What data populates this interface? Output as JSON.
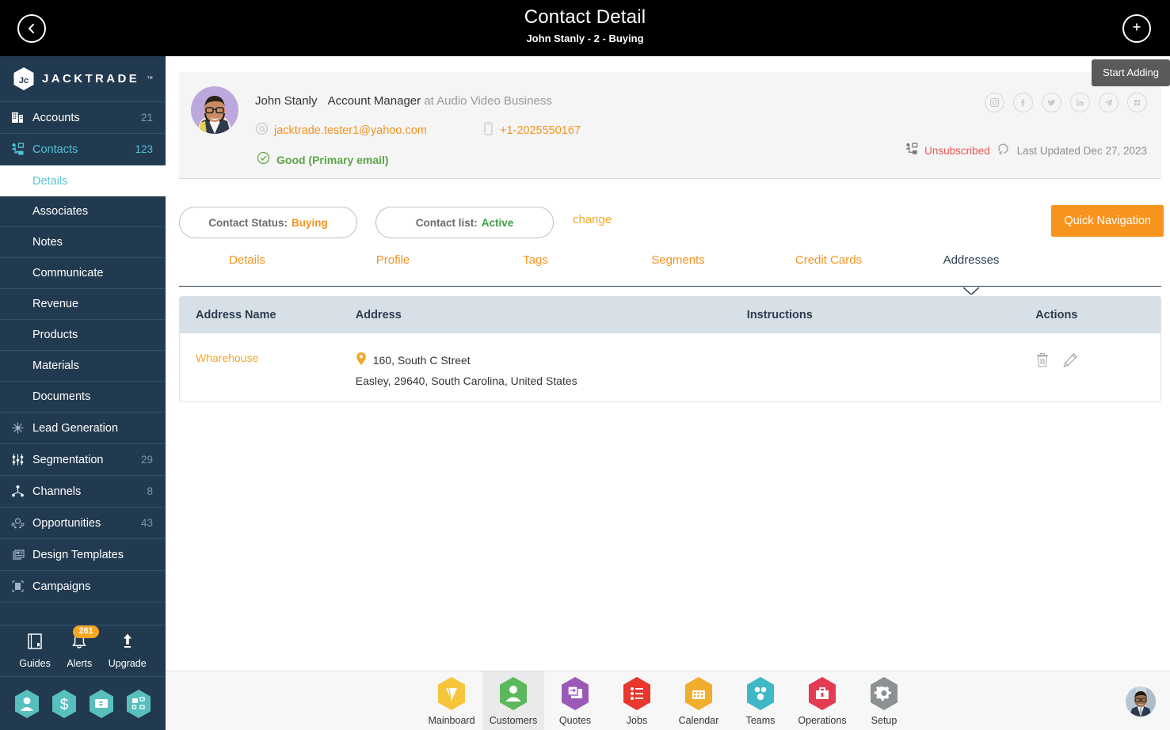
{
  "header": {
    "title": "Contact Detail",
    "subtitle": "John Stanly - 2 - Buying",
    "back_icon": "chevron-left-icon",
    "add_icon": "plus-icon",
    "tooltip": "Start Adding"
  },
  "sidebar": {
    "brand": "JACKTRADE",
    "brand_tm": "™",
    "items": [
      {
        "label": "Accounts",
        "count": "21",
        "icon": "building-icon",
        "active": false
      },
      {
        "label": "Contacts",
        "count": "123",
        "icon": "contacts-icon",
        "active": true
      }
    ],
    "sub_items": [
      {
        "label": "Details",
        "selected": true
      },
      {
        "label": "Associates",
        "selected": false
      },
      {
        "label": "Notes",
        "selected": false
      },
      {
        "label": "Communicate",
        "selected": false
      },
      {
        "label": "Revenue",
        "selected": false
      },
      {
        "label": "Products",
        "selected": false
      },
      {
        "label": "Materials",
        "selected": false
      },
      {
        "label": "Documents",
        "selected": false
      }
    ],
    "items2": [
      {
        "label": "Lead Generation",
        "count": "",
        "icon": "lead-generation-icon"
      },
      {
        "label": "Segmentation",
        "count": "29",
        "icon": "segmentation-icon"
      },
      {
        "label": "Channels",
        "count": "8",
        "icon": "channels-icon"
      },
      {
        "label": "Opportunities",
        "count": "43",
        "icon": "opportunities-icon"
      },
      {
        "label": "Design Templates",
        "count": "",
        "icon": "design-templates-icon"
      },
      {
        "label": "Campaigns",
        "count": "",
        "icon": "campaigns-icon"
      }
    ],
    "footer": [
      {
        "label": "Guides",
        "icon": "book-icon",
        "badge": ""
      },
      {
        "label": "Alerts",
        "icon": "bell-icon",
        "badge": "261"
      },
      {
        "label": "Upgrade",
        "icon": "upload-arrow-icon",
        "badge": ""
      }
    ],
    "quick_icons": [
      {
        "icon": "person-hex-icon"
      },
      {
        "icon": "dollar-hex-icon"
      },
      {
        "icon": "payment-hex-icon"
      },
      {
        "icon": "workflow-hex-icon"
      }
    ]
  },
  "contact": {
    "name": "John Stanly",
    "role": "Account Manager",
    "company": "at Audio Video Business",
    "email": "jacktrade.tester1@yahoo.com",
    "phone": "+1-2025550167",
    "email_status": "Good (Primary email)",
    "subscription": "Unsubscribed",
    "last_updated": "Last Updated Dec 27, 2023",
    "socials": [
      {
        "icon": "instagram-icon",
        "glyph": ""
      },
      {
        "icon": "facebook-icon",
        "glyph": "f"
      },
      {
        "icon": "twitter-icon",
        "glyph": ""
      },
      {
        "icon": "linkedin-icon",
        "glyph": "in"
      },
      {
        "icon": "telegram-icon",
        "glyph": ""
      },
      {
        "icon": "apps-grid-icon",
        "glyph": ""
      }
    ]
  },
  "chips": {
    "status_key": "Contact Status:",
    "status_value": "Buying",
    "list_key": "Contact list:",
    "list_value": "Active",
    "change_label": "change",
    "quick_navigation": "Quick Navigation"
  },
  "tabs": [
    {
      "label": "Details",
      "active": false
    },
    {
      "label": "Profile",
      "active": false
    },
    {
      "label": "Tags",
      "active": false
    },
    {
      "label": "Segments",
      "active": false
    },
    {
      "label": "Credit Cards",
      "active": false
    },
    {
      "label": "Addresses",
      "active": true
    }
  ],
  "table": {
    "columns": [
      "Address Name",
      "Address",
      "Instructions",
      "Actions"
    ],
    "rows": [
      {
        "address_name": "Wharehouse",
        "address_line1": "160, South C Street",
        "address_line2": "Easley, 29640, South Carolina, United States",
        "instructions": "",
        "actions": [
          "delete-icon",
          "edit-icon"
        ]
      }
    ]
  },
  "bottom_nav": [
    {
      "label": "Mainboard",
      "icon": "mainboard-icon",
      "color": "#f5c63c",
      "active": false
    },
    {
      "label": "Customers",
      "icon": "customers-icon",
      "color": "#5cb85c",
      "active": true
    },
    {
      "label": "Quotes",
      "icon": "quotes-icon",
      "color": "#9b59b6",
      "active": false
    },
    {
      "label": "Jobs",
      "icon": "jobs-icon",
      "color": "#e8372c",
      "active": false
    },
    {
      "label": "Calendar",
      "icon": "calendar-icon",
      "color": "#f0ad2e",
      "active": false
    },
    {
      "label": "Teams",
      "icon": "teams-icon",
      "color": "#3eb8c4",
      "active": false
    },
    {
      "label": "Operations",
      "icon": "operations-icon",
      "color": "#e23b52",
      "active": false
    },
    {
      "label": "Setup",
      "icon": "setup-icon",
      "color": "#8c9193",
      "active": false
    }
  ],
  "colors": {
    "sidebar_bg": "#223a4f",
    "accent_orange": "#f5931e",
    "accent_teal": "#4fc3d9",
    "header_bg": "#000000",
    "table_header_bg": "#d6e0e6"
  }
}
